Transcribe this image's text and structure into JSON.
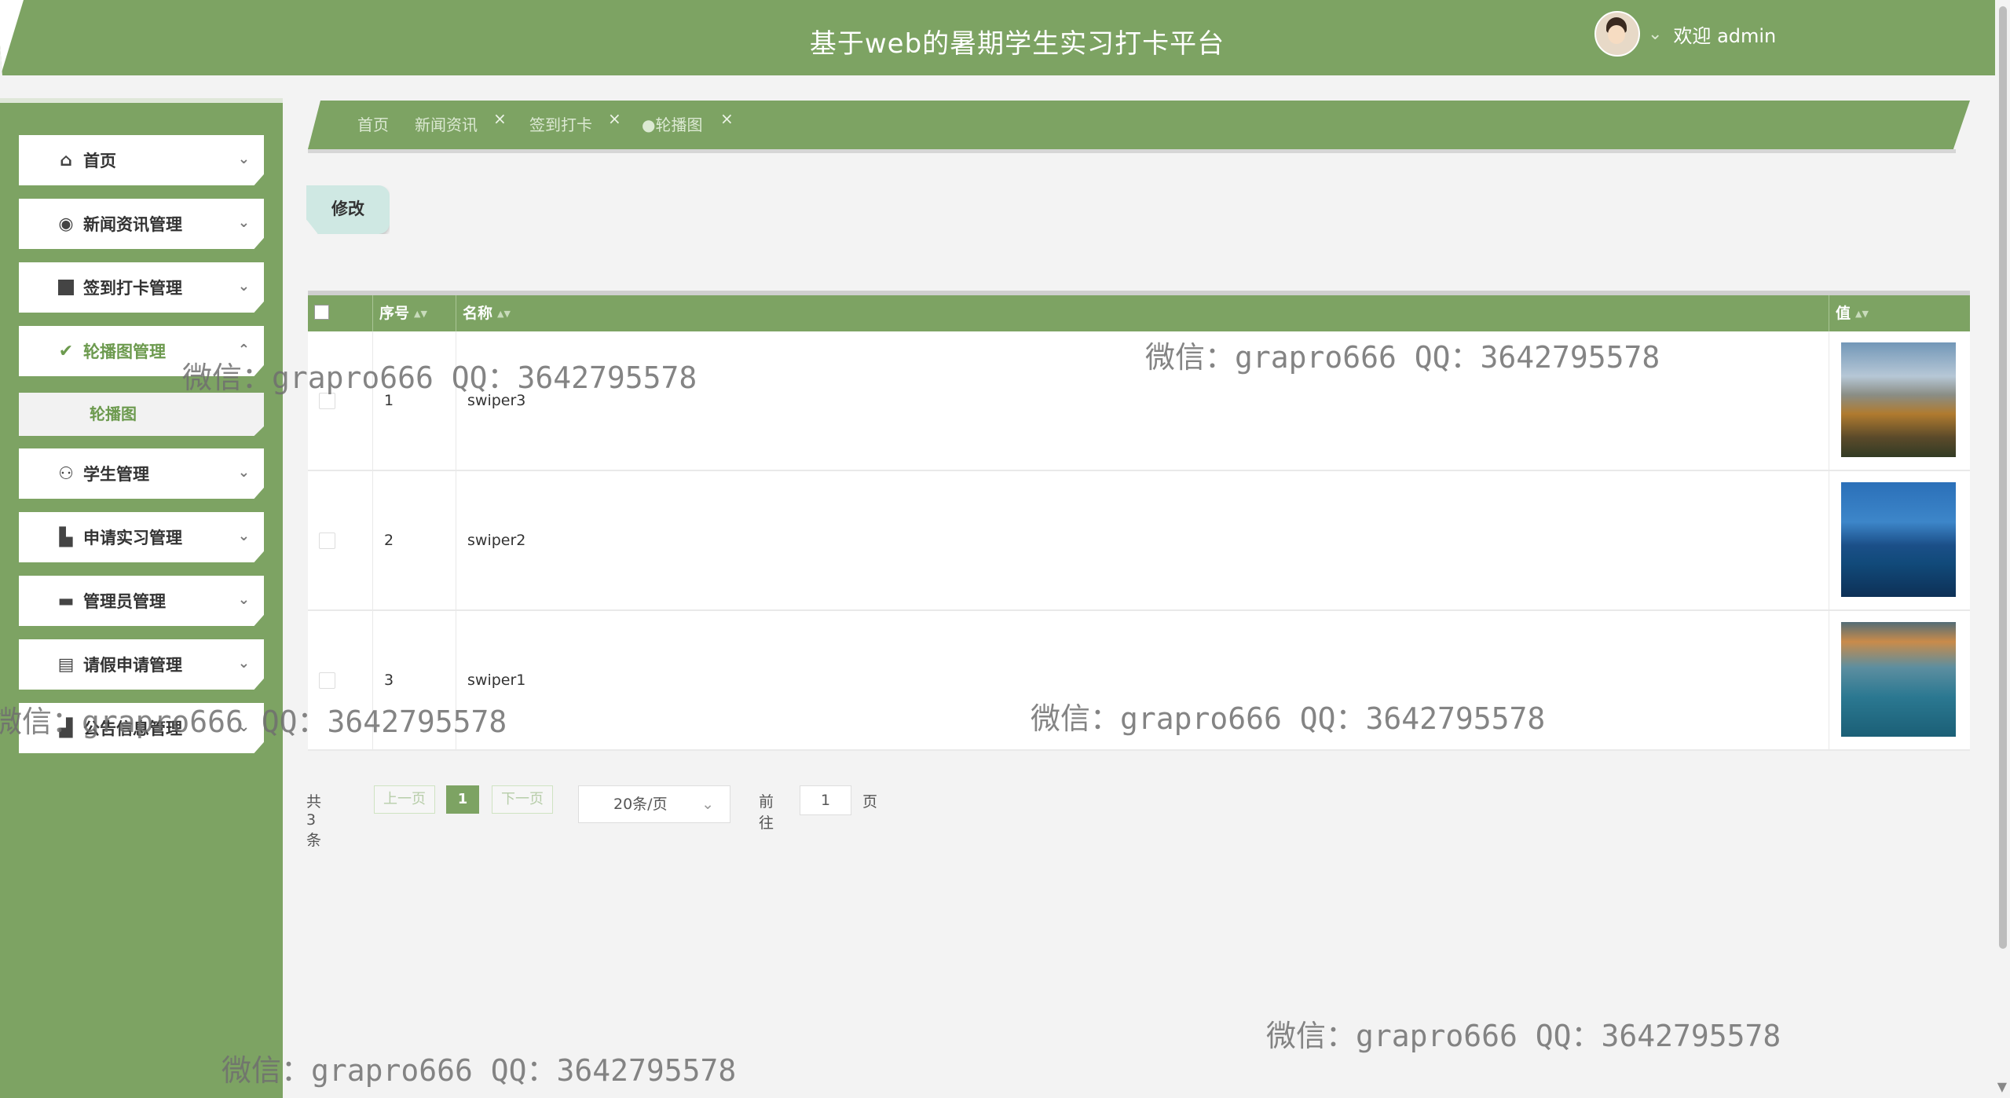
{
  "header": {
    "title": "基于web的暑期学生实习打卡平台",
    "welcome": "欢迎 admin"
  },
  "sidebar": {
    "items": [
      {
        "label": "首页",
        "icon": "home-icon"
      },
      {
        "label": "新闻资讯管理",
        "icon": "circle-dot-icon"
      },
      {
        "label": "签到打卡管理",
        "icon": "checkin-icon"
      },
      {
        "label": "轮播图管理",
        "icon": "check-circle-icon"
      },
      {
        "label": "学生管理",
        "icon": "user-icon"
      },
      {
        "label": "申请实习管理",
        "icon": "grid-icon"
      },
      {
        "label": "管理员管理",
        "icon": "monitor-icon"
      },
      {
        "label": "请假申请管理",
        "icon": "tray-icon"
      },
      {
        "label": "公告信息管理",
        "icon": "notice-icon"
      }
    ],
    "subitem": "轮播图"
  },
  "tabs": [
    {
      "label": "首页"
    },
    {
      "label": "新闻资讯"
    },
    {
      "label": "签到打卡"
    },
    {
      "label": "●轮播图"
    }
  ],
  "toolbar": {
    "edit_label": "修改"
  },
  "table": {
    "columns": [
      "序号",
      "名称",
      "值"
    ],
    "rows": [
      {
        "index": "1",
        "name": "swiper3"
      },
      {
        "index": "2",
        "name": "swiper2"
      },
      {
        "index": "3",
        "name": "swiper1"
      }
    ]
  },
  "pagination": {
    "total": "共 3 条",
    "prev": "上一页",
    "current": "1",
    "next": "下一页",
    "page_size": "20条/页",
    "goto_prefix": "前往",
    "goto_value": "1",
    "goto_suffix": "页"
  },
  "watermark": "微信：grapro666 QQ：3642795578",
  "colors": {
    "primary": "#7da363",
    "edit_button": "#cfe8e3",
    "active_text": "#6c9a4e"
  }
}
